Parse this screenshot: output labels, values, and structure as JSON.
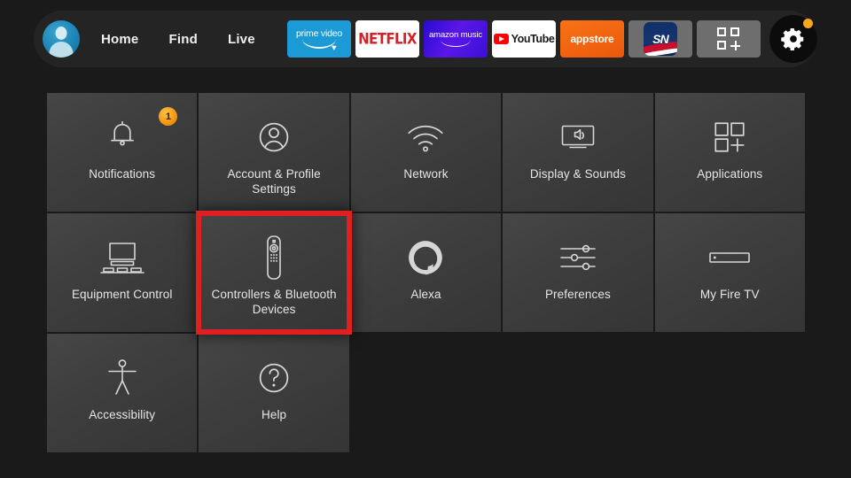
{
  "app": {
    "screen_title": "Fire TV Settings",
    "background_color": "#1a1a1a"
  },
  "topbar": {
    "avatar_name": "profile-avatar",
    "nav": [
      {
        "label": "Home"
      },
      {
        "label": "Find"
      },
      {
        "label": "Live"
      }
    ],
    "apps": [
      {
        "name": "prime-video",
        "text": "prime video"
      },
      {
        "name": "netflix",
        "text": "NETFLIX"
      },
      {
        "name": "amazon-music",
        "text": "amazon music"
      },
      {
        "name": "youtube",
        "text": "YouTube"
      },
      {
        "name": "appstore",
        "text": "appstore"
      },
      {
        "name": "sportsnet",
        "text": "SN"
      },
      {
        "name": "app-library",
        "text": ""
      }
    ],
    "settings_button": {
      "label": "Settings",
      "has_notification_dot": true,
      "dot_color": "#f5a623"
    }
  },
  "settings_grid": {
    "selected_tile": "Controllers & Bluetooth Devices",
    "selection_color": "#e02020",
    "tiles": [
      {
        "label": "Notifications",
        "icon": "bell-icon",
        "badge": "1",
        "selected": false
      },
      {
        "label": "Account & Profile Settings",
        "icon": "person-circle-icon",
        "badge": null,
        "selected": false
      },
      {
        "label": "Network",
        "icon": "wifi-icon",
        "badge": null,
        "selected": false
      },
      {
        "label": "Display & Sounds",
        "icon": "tv-speaker-icon",
        "badge": null,
        "selected": false
      },
      {
        "label": "Applications",
        "icon": "app-grid-plus-icon",
        "badge": null,
        "selected": false
      },
      {
        "label": "Equipment Control",
        "icon": "tv-equipment-icon",
        "badge": null,
        "selected": false
      },
      {
        "label": "Controllers & Bluetooth Devices",
        "icon": "remote-control-icon",
        "badge": null,
        "selected": true
      },
      {
        "label": "Alexa",
        "icon": "alexa-ring-icon",
        "badge": null,
        "selected": false
      },
      {
        "label": "Preferences",
        "icon": "sliders-icon",
        "badge": null,
        "selected": false
      },
      {
        "label": "My Fire TV",
        "icon": "fire-stick-icon",
        "badge": null,
        "selected": false
      },
      {
        "label": "Accessibility",
        "icon": "accessibility-person-icon",
        "badge": null,
        "selected": false
      },
      {
        "label": "Help",
        "icon": "question-circle-icon",
        "badge": null,
        "selected": false
      }
    ]
  }
}
